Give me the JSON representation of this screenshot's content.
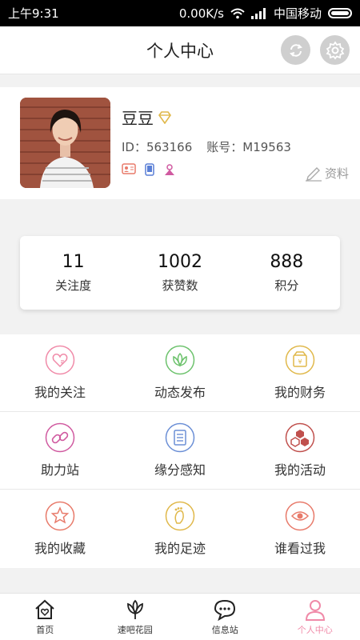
{
  "status_bar": {
    "time": "上午9:31",
    "speed": "0.00K/s",
    "carrier": "中国移动"
  },
  "header": {
    "title": "个人中心"
  },
  "profile": {
    "name": "豆豆",
    "id_text": "ID：563166",
    "account_text": "账号：M19563",
    "edit_label": "资料"
  },
  "stats": [
    {
      "value": "11",
      "label": "关注度"
    },
    {
      "value": "1002",
      "label": "获赞数"
    },
    {
      "value": "888",
      "label": "积分"
    }
  ],
  "menu": {
    "row1": [
      "我的关注",
      "动态发布",
      "我的财务"
    ],
    "row2": [
      "助力站",
      "缘分感知",
      "我的活动"
    ],
    "row3": [
      "我的收藏",
      "我的足迹",
      "谁看过我"
    ]
  },
  "tabs": [
    "首页",
    "速吧花园",
    "信息站",
    "个人中心"
  ],
  "colors": {
    "accent": "#f08aa8",
    "green": "#6cc26c",
    "gold": "#e0b84a",
    "red": "#c0504d",
    "blue": "#6b8fd6"
  }
}
